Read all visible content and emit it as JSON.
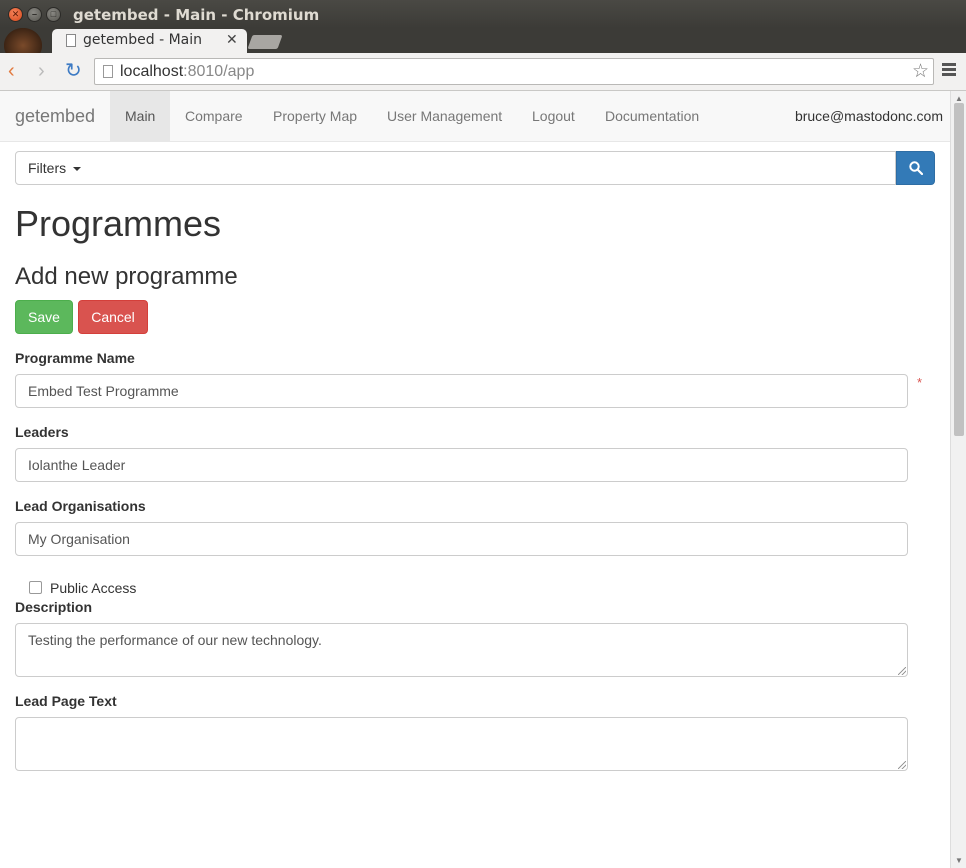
{
  "window": {
    "title": "getembed - Main - Chromium",
    "close_glyph": "✕",
    "minimize_glyph": "–",
    "maximize_glyph": "□"
  },
  "tab": {
    "title": "getembed - Main",
    "close_glyph": "✕"
  },
  "toolbar": {
    "url_host": "localhost",
    "url_rest": ":8010/app",
    "back_icon": "‹",
    "forward_icon": "›",
    "reload_icon": "↻",
    "bookmark_icon": "☆"
  },
  "navbar": {
    "brand": "getembed",
    "items": [
      {
        "label": "Main",
        "active": true
      },
      {
        "label": "Compare"
      },
      {
        "label": "Property Map"
      },
      {
        "label": "User Management"
      },
      {
        "label": "Logout"
      },
      {
        "label": "Documentation"
      }
    ],
    "user": "bruce@mastodonc.com"
  },
  "filters": {
    "button_label": "Filters",
    "search_value": ""
  },
  "page": {
    "title": "Programmes",
    "form_title": "Add new programme"
  },
  "buttons": {
    "save": "Save",
    "cancel": "Cancel"
  },
  "form": {
    "programme_name_label": "Programme Name",
    "programme_name_value": "Embed Test Programme",
    "required_marker": "*",
    "leaders_label": "Leaders",
    "leaders_value": "Iolanthe Leader",
    "lead_org_label": "Lead Organisations",
    "lead_org_value": "My Organisation",
    "public_access_label": "Public Access",
    "public_access_checked": false,
    "description_label": "Description",
    "description_value": "Testing the performance of our new technology.",
    "lead_page_text_label": "Lead Page Text",
    "lead_page_text_value": ""
  },
  "colors": {
    "save": "#5cb85c",
    "cancel": "#d9534f",
    "search_button": "#337ab7",
    "required": "#d9534f"
  }
}
